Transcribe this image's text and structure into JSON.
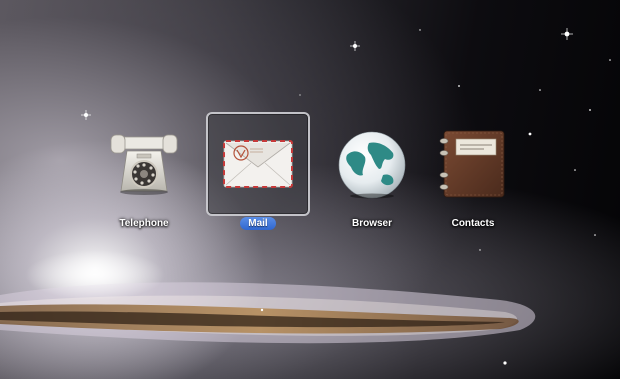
{
  "launcher": {
    "items": [
      {
        "label": "Telephone",
        "icon": "telephone-icon"
      },
      {
        "label": "Mail",
        "icon": "mail-icon",
        "selected": true
      },
      {
        "label": "Browser",
        "icon": "globe-icon"
      },
      {
        "label": "Contacts",
        "icon": "address-book-icon"
      }
    ]
  },
  "colors": {
    "selection_label": "#3a72d8",
    "selection_border": "#d2d2d7"
  }
}
